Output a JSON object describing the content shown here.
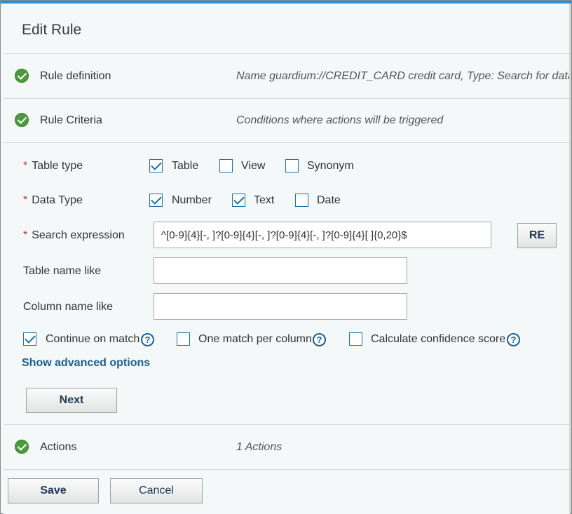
{
  "dialog": {
    "title": "Edit Rule"
  },
  "sections": [
    {
      "label": "Rule definition",
      "description": "Name guardium://CREDIT_CARD credit card, Type: Search for data"
    },
    {
      "label": "Rule Criteria",
      "description": "Conditions where actions will be triggered"
    },
    {
      "label": "Actions",
      "description": "1 Actions"
    }
  ],
  "criteria": {
    "required_marker": "*",
    "table_type": {
      "label": "Table type",
      "options": [
        {
          "label": "Table",
          "checked": true
        },
        {
          "label": "View",
          "checked": false
        },
        {
          "label": "Synonym",
          "checked": false
        }
      ]
    },
    "data_type": {
      "label": "Data Type",
      "options": [
        {
          "label": "Number",
          "checked": true
        },
        {
          "label": "Text",
          "checked": true
        },
        {
          "label": "Date",
          "checked": false
        }
      ]
    },
    "search_expression": {
      "label": "Search expression",
      "value": "^[0-9]{4}[-, ]?[0-9]{4}[-, ]?[0-9]{4}[-, ]?[0-9]{4}[ ]{0,20}$",
      "re_button": "RE"
    },
    "table_name_like": {
      "label": "Table name like",
      "value": ""
    },
    "column_name_like": {
      "label": "Column name like",
      "value": ""
    },
    "options": [
      {
        "label": "Continue on match",
        "checked": true
      },
      {
        "label": "One match per column",
        "checked": false
      },
      {
        "label": "Calculate confidence score",
        "checked": false
      }
    ],
    "help_glyph": "?",
    "advanced_link": "Show advanced options",
    "next_button": "Next"
  },
  "footer": {
    "save_label": "Save",
    "cancel_label": "Cancel"
  },
  "colors": {
    "accent": "#2a8fd0",
    "check_green": "#4a9a3e",
    "link": "#1b5f8c",
    "required": "#c0392b"
  }
}
